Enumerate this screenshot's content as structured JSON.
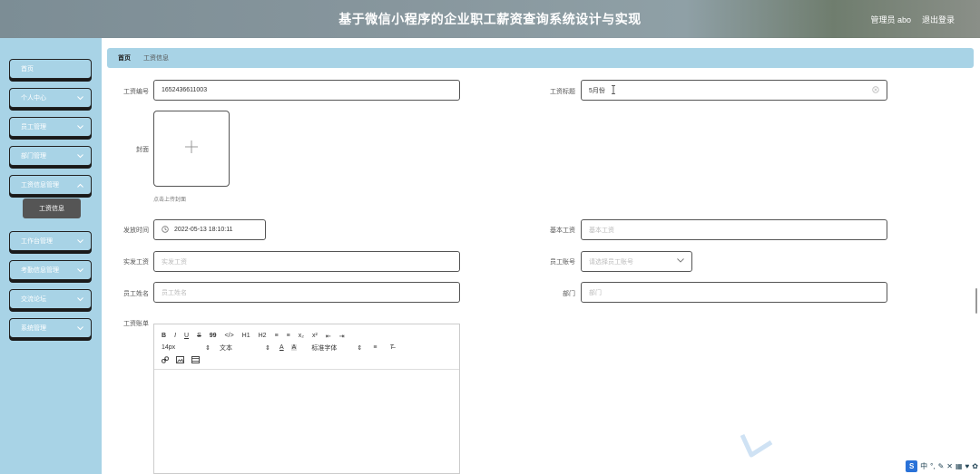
{
  "header": {
    "title": "基于微信小程序的企业职工薪资查询系统设计与实现",
    "user_label": "管理员 abo",
    "logout_label": "退出登录"
  },
  "sidebar": {
    "items": [
      {
        "label": "首页",
        "has_children": false
      },
      {
        "label": "个人中心",
        "has_children": true
      },
      {
        "label": "员工管理",
        "has_children": true
      },
      {
        "label": "部门管理",
        "has_children": true
      },
      {
        "label": "工资信息管理",
        "has_children": true
      },
      {
        "label": "工作台管理",
        "has_children": true
      },
      {
        "label": "考勤信息管理",
        "has_children": true
      },
      {
        "label": "交流论坛",
        "has_children": true
      },
      {
        "label": "系统管理",
        "has_children": true
      }
    ],
    "active_sub": "工资信息"
  },
  "breadcrumb": {
    "home": "首页",
    "current": "工资信息"
  },
  "form": {
    "salary_no": {
      "label": "工资编号",
      "value": "1652436611003"
    },
    "salary_title": {
      "label": "工资标题",
      "value": "5月份"
    },
    "cover": {
      "label": "封面",
      "hint": "点击上传封面"
    },
    "issue_time": {
      "label": "发放时间",
      "value": "2022-05-13 18:10:11"
    },
    "base_salary": {
      "label": "基本工资",
      "placeholder": "基本工资"
    },
    "actual_salary": {
      "label": "实发工资",
      "placeholder": "实发工资"
    },
    "employee_account": {
      "label": "员工账号",
      "placeholder": "请选择员工账号"
    },
    "employee_name": {
      "label": "员工姓名",
      "placeholder": "员工姓名"
    },
    "department": {
      "label": "部门",
      "placeholder": "部门"
    },
    "salary_bill": {
      "label": "工资账单"
    }
  },
  "editor": {
    "row1": [
      "B",
      "I",
      "U",
      "S",
      "99",
      "</>",
      "H1",
      "H2",
      "≡",
      "≡",
      "x₂",
      "x²",
      "⇤",
      "⇥"
    ],
    "font_size": "14px",
    "text_style": "文本",
    "font_family": "标准字体"
  },
  "tray": {
    "logo": "S",
    "ime": "中"
  }
}
